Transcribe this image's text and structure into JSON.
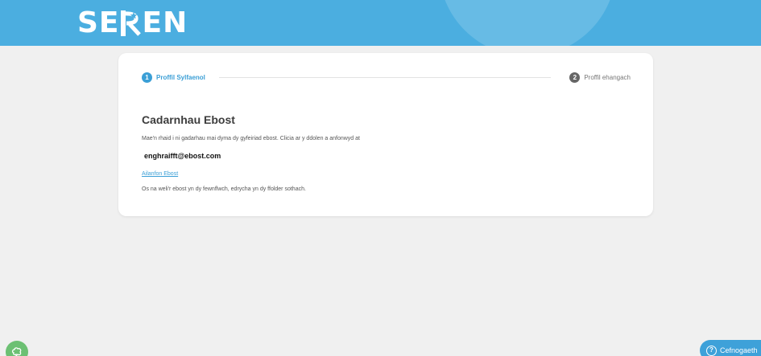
{
  "header": {
    "logo_parts": [
      "SE",
      "R",
      "EN"
    ],
    "brand_color": "#4baee0"
  },
  "stepper": {
    "steps": [
      {
        "number": "1",
        "label": "Proffil Sylfaenol",
        "state": "active"
      },
      {
        "number": "2",
        "label": "Proffil ehangach",
        "state": "inactive"
      }
    ],
    "active_color": "#3b9fd6"
  },
  "main": {
    "title": "Cadarnhau Ebost",
    "description": "Mae'n rhaid i ni gadarhau mai dyma dy gyfeiriad ebost. Clicia ar y ddolen a anfonwyd at",
    "email": "enghraifft@ebost.com",
    "resend_link": "Ailanfon Ebost",
    "hint": "Os na weli'r ebost yn dy fewnflwch, edrycha yn dy ffolder sothach."
  },
  "corner": {
    "left_icon": "brain-icon",
    "help_icon": "question-icon",
    "help_label": "Cefnogaeth"
  }
}
